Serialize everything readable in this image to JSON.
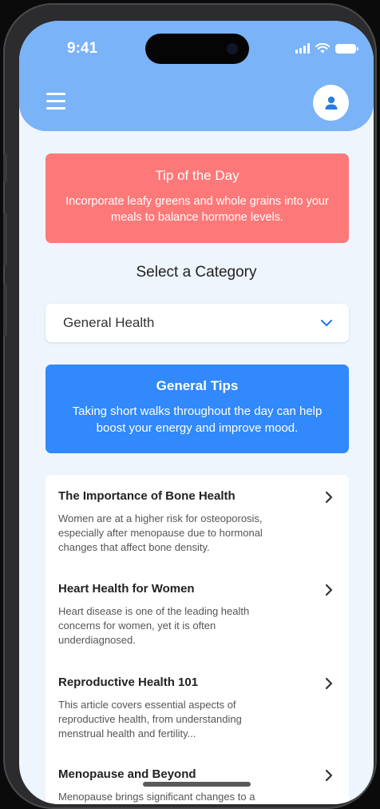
{
  "status_bar": {
    "time": "9:41"
  },
  "header": {
    "menu_icon": "hamburger-menu-icon",
    "profile_icon": "user-icon"
  },
  "tip_of_day": {
    "title": "Tip of the Day",
    "text": "Incorporate leafy greens and whole grains into your meals to balance hormone levels."
  },
  "category": {
    "heading": "Select a Category",
    "selected": "General Health",
    "chevron_icon": "chevron-down-icon"
  },
  "general_tips": {
    "title": "General Tips",
    "text": "Taking short walks throughout the day can help boost your energy and improve mood."
  },
  "articles": [
    {
      "title": "The Importance of Bone Health",
      "desc": "Women are at a higher risk for osteoporosis, especially after menopause due to hormonal changes that affect bone density."
    },
    {
      "title": "Heart Health for Women",
      "desc": "Heart disease is one of the leading health concerns for women, yet it is often underdiagnosed."
    },
    {
      "title": "Reproductive Health 101",
      "desc": "This article covers essential aspects of reproductive health, from understanding menstrual health and fertility..."
    },
    {
      "title": "Menopause and Beyond",
      "desc": "Menopause brings significant changes to a"
    }
  ],
  "colors": {
    "header_bg": "#7ab3f7",
    "tip_card_bg": "#fd7878",
    "general_card_bg": "#3189fb",
    "accent": "#2a7de1",
    "screen_bg": "#eef5fd"
  }
}
